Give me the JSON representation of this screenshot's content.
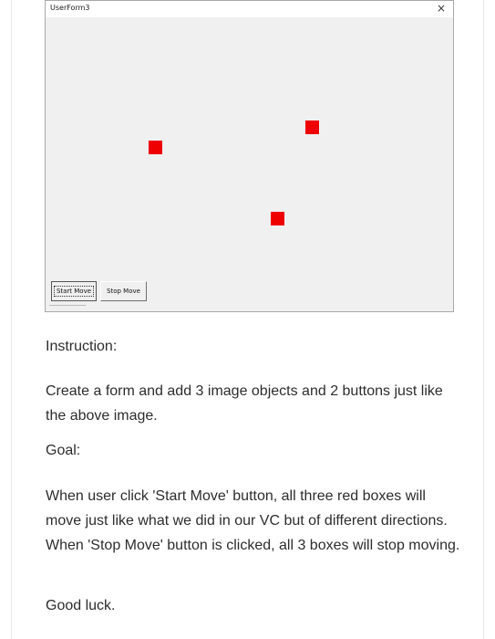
{
  "userform": {
    "title": "UserForm3",
    "close_symbol": "×",
    "close_icon": "close-icon",
    "box_color": "#ee0000",
    "buttons": {
      "start_label": "Start Move",
      "stop_label": "Stop Move"
    }
  },
  "content": {
    "instruction_heading": "Instruction:",
    "instruction_body": "Create a form and add 3 image objects and 2 buttons just like the above image.",
    "goal_heading": "Goal:",
    "goal_body": "When user click 'Start Move' button, all three red boxes will move just like what we did in our VC but of different directions. When 'Stop Move' button is clicked, all 3 boxes will stop moving.",
    "closing": "Good luck."
  }
}
